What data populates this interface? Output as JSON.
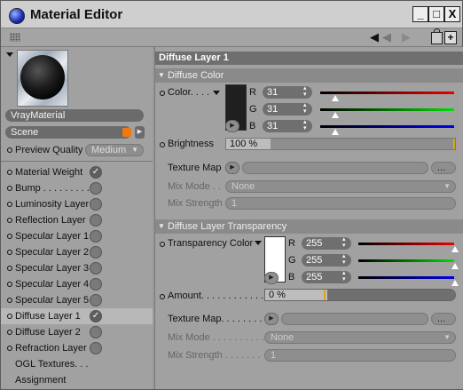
{
  "window": {
    "title": "Material Editor",
    "buttons": {
      "minimize": "_",
      "maximize": "□",
      "close": "X"
    }
  },
  "toolbar": {
    "nav_back": "◀",
    "nav_forward": "▶",
    "lock": "🔒",
    "new": "+"
  },
  "left": {
    "material_name": "VrayMaterial",
    "scene_label": "Scene",
    "scene_color": "#f07a10",
    "preview_quality_label": "Preview Quality",
    "preview_quality_value": "Medium",
    "channels": [
      {
        "label": "Material Weight",
        "checked": true
      },
      {
        "label": "Bump . . . . . . . . .",
        "checked": false
      },
      {
        "label": "Luminosity Layer",
        "checked": false
      },
      {
        "label": "Reflection Layer",
        "checked": false
      },
      {
        "label": "Specular Layer 1",
        "checked": false
      },
      {
        "label": "Specular Layer 2",
        "checked": false
      },
      {
        "label": "Specular Layer 3",
        "checked": false
      },
      {
        "label": "Specular Layer 4",
        "checked": false
      },
      {
        "label": "Specular Layer 5",
        "checked": false
      },
      {
        "label": "Diffuse Layer 1",
        "checked": true
      },
      {
        "label": "Diffuse Layer 2",
        "checked": false
      },
      {
        "label": "Refraction Layer",
        "checked": false
      }
    ],
    "ogl_textures": "OGL Textures. . .",
    "assignment": "Assignment"
  },
  "right": {
    "header": "Diffuse Layer 1",
    "diffuse_color_section": "Diffuse Color",
    "color_label": "Color. . . .",
    "color": {
      "r": "31",
      "g": "31",
      "b": "31",
      "hex": "#1f1f1f",
      "r_frac": 0.12,
      "g_frac": 0.12,
      "b_frac": 0.12
    },
    "r_label": "R",
    "g_label": "G",
    "b_label": "B",
    "brightness_label": "Brightness",
    "brightness_value": "100 %",
    "texture_map_label": "Texture Map",
    "ellipsis": "...",
    "mix_mode_label": "Mix Mode . .",
    "mix_mode_value": "None",
    "mix_strength_label": "Mix Strength",
    "mix_strength_value": "1",
    "transparency_section": "Diffuse Layer Transparency",
    "transparency_color_label": "Transparency Color",
    "transparency": {
      "r": "255",
      "g": "255",
      "b": "255",
      "hex": "#ffffff"
    },
    "amount_label": "Amount. . . . . . . . . . . .",
    "amount_value": "0 %",
    "t_texture_map_label": "Texture Map. . . . . . . .",
    "t_mix_mode_label": "Mix Mode . . . . . . . . . .",
    "t_mix_mode_value": "None",
    "t_mix_strength_label": "Mix Strength . . . . . . .",
    "t_mix_strength_value": "1"
  }
}
